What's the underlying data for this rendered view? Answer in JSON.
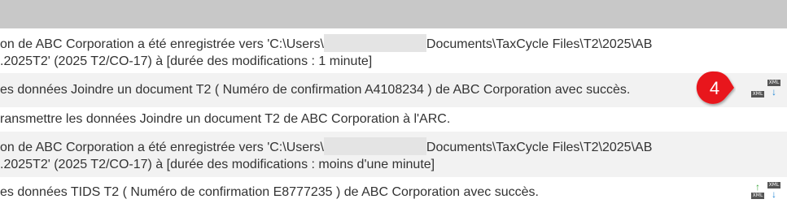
{
  "rows": [
    {
      "line1_prefix": "on de ABC Corporation a été enregistrée vers 'C:\\Users\\",
      "line1_suffix": "Documents\\TaxCycle Files\\T2\\2025\\AB",
      "line2": ".2025T2' (2025 T2/CO-17)  à [durée des modifications : 1 minute]"
    },
    {
      "line1": "es données Joindre un document T2  ( Numéro de confirmation A4108234 ) de ABC Corporation avec succès."
    },
    {
      "line1": "ransmettre les données Joindre un document T2 de ABC Corporation à l'ARC."
    },
    {
      "line1_prefix": "on de ABC Corporation a été enregistrée vers 'C:\\Users\\",
      "line1_suffix": "Documents\\TaxCycle Files\\T2\\2025\\AB",
      "line2": ".2025T2' (2025 T2/CO-17)  à [durée des modifications : moins d'une minute]"
    },
    {
      "line1": "es données TIDS T2  ( Numéro de confirmation E8777235 ) de ABC Corporation avec succès."
    }
  ],
  "icons": {
    "xml_label": "XML",
    "upload_icon": "xml-upload-icon",
    "download_icon": "xml-download-icon"
  },
  "callout": {
    "number": "4",
    "color": "#e8141b"
  }
}
